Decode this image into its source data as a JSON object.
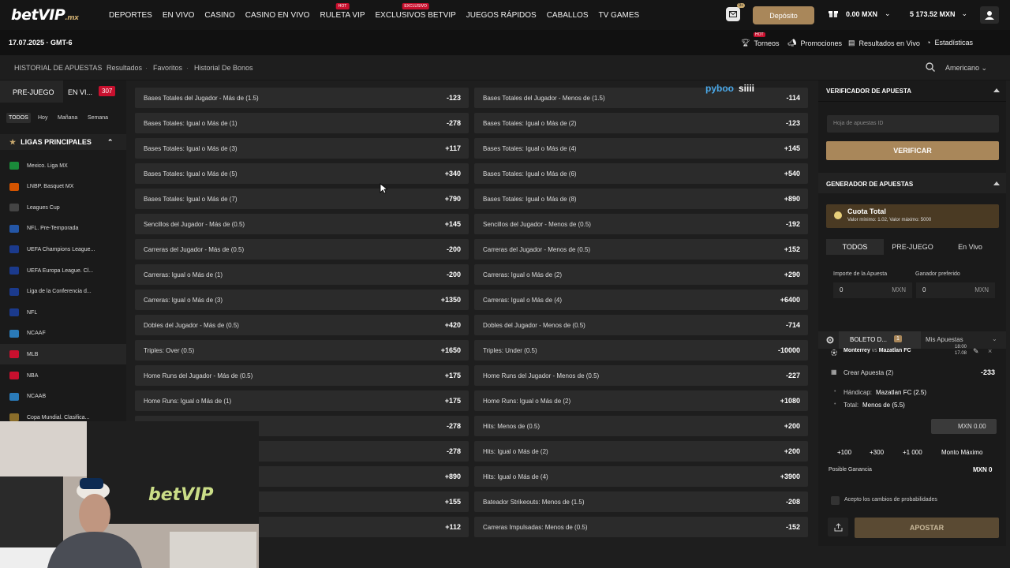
{
  "brand": {
    "logo": "betVIP",
    "logo_suffix": ".mx"
  },
  "nav": {
    "items": [
      {
        "label": "DEPORTES"
      },
      {
        "label": "EN VIVO"
      },
      {
        "label": "CASINO"
      },
      {
        "label": "CASINO EN VIVO"
      },
      {
        "label": "RULETA VIP",
        "badge": "HOT"
      },
      {
        "label": "EXCLUSIVOS BETVIP",
        "badge": "EXCLUSIVO"
      },
      {
        "label": "JUEGOS RÁPIDOS"
      },
      {
        "label": "CABALLOS"
      },
      {
        "label": "TV GAMES"
      }
    ],
    "mail_count": "9+",
    "deposit_label": "Depósito",
    "balance_bonus": "0.00 MXN",
    "balance_main": "5 173.52 MXN"
  },
  "subbar": {
    "date": "17.07.2025 · GMT-6",
    "torneos": "Torneos",
    "torneos_badge": "HOT",
    "promociones": "Promociones",
    "resultados": "Resultados en Vivo",
    "estadisticas": "Estadísticas"
  },
  "breadcrumbs": [
    "HISTORIAL DE APUESTAS",
    "Resultados",
    "Favoritos",
    "Historial De Bonos"
  ],
  "odds_format": "Americano",
  "sidebar": {
    "tab_prematch": "PRE-JUEGO",
    "tab_live": "EN VI...",
    "live_count": "307",
    "filters": [
      "TODOS",
      "Hoy",
      "Mañana",
      "Semana"
    ],
    "ligas_title": "LIGAS PRINCIPALES",
    "leagues": [
      {
        "label": "Mexico. Liga MX",
        "color": "#1a8a3a"
      },
      {
        "label": "LNBP. Basquet MX",
        "color": "#d35400"
      },
      {
        "label": "Leagues Cup",
        "color": "#444"
      },
      {
        "label": "NFL. Pre-Temporada",
        "color": "#2456a6"
      },
      {
        "label": "UEFA Champions League...",
        "color": "#1b3a8c"
      },
      {
        "label": "UEFA Europa League. Cl...",
        "color": "#1b3a8c"
      },
      {
        "label": "Liga de la Conferencia d...",
        "color": "#1b3a8c"
      },
      {
        "label": "NFL",
        "color": "#1b3a8c"
      },
      {
        "label": "NCAAF",
        "color": "#2a7ab8"
      },
      {
        "label": "MLB",
        "color": "#c8102e"
      },
      {
        "label": "NBA",
        "color": "#c8102e"
      },
      {
        "label": "NCAAB",
        "color": "#2a7ab8"
      },
      {
        "label": "Copa Mundial. Clasifica...",
        "color": "#8a6d2a"
      }
    ]
  },
  "markets_left": [
    {
      "label": "Bases Totales del Jugador - Más de (1.5)",
      "odd": "-123"
    },
    {
      "label": "Bases Totales: Igual o Más de (1)",
      "odd": "-278"
    },
    {
      "label": "Bases Totales: Igual o Más de (3)",
      "odd": "+117"
    },
    {
      "label": "Bases Totales: Igual o Más de (5)",
      "odd": "+340"
    },
    {
      "label": "Bases Totales: Igual o Más de (7)",
      "odd": "+790"
    },
    {
      "label": "Sencillos del Jugador - Más de (0.5)",
      "odd": "+145"
    },
    {
      "label": "Carreras del Jugador - Más de (0.5)",
      "odd": "-200"
    },
    {
      "label": "Carreras: Igual o Más de (1)",
      "odd": "-200"
    },
    {
      "label": "Carreras: Igual o Más de (3)",
      "odd": "+1350"
    },
    {
      "label": "Dobles del Jugador - Más de (0.5)",
      "odd": "+420"
    },
    {
      "label": "Triples: Over (0.5)",
      "odd": "+1650"
    },
    {
      "label": "Home Runs del Jugador - Más de (0.5)",
      "odd": "+175"
    },
    {
      "label": "Home Runs: Igual o Más de (1)",
      "odd": "+175"
    },
    {
      "label": "",
      "odd": "-278"
    },
    {
      "label": "",
      "odd": "-278"
    },
    {
      "label": "",
      "odd": "+890"
    },
    {
      "label": "",
      "odd": "+155"
    },
    {
      "label": "",
      "odd": "+112"
    }
  ],
  "markets_right": [
    {
      "label": "Bases Totales del Jugador - Menos de (1.5)",
      "odd": "-114"
    },
    {
      "label": "Bases Totales: Igual o Más de (2)",
      "odd": "-123"
    },
    {
      "label": "Bases Totales: Igual o Más de (4)",
      "odd": "+145"
    },
    {
      "label": "Bases Totales: Igual o Más de (6)",
      "odd": "+540"
    },
    {
      "label": "Bases Totales: Igual o Más de (8)",
      "odd": "+890"
    },
    {
      "label": "Sencillos del Jugador - Menos de (0.5)",
      "odd": "-192"
    },
    {
      "label": "Carreras del Jugador - Menos de (0.5)",
      "odd": "+152"
    },
    {
      "label": "Carreras: Igual o Más de (2)",
      "odd": "+290"
    },
    {
      "label": "Carreras: Igual o Más de (4)",
      "odd": "+6400"
    },
    {
      "label": "Dobles del Jugador - Menos de (0.5)",
      "odd": "-714"
    },
    {
      "label": "Triples: Under (0.5)",
      "odd": "-10000"
    },
    {
      "label": "Home Runs del Jugador - Menos de (0.5)",
      "odd": "-227"
    },
    {
      "label": "Home Runs: Igual o Más de (2)",
      "odd": "+1080"
    },
    {
      "label": "Hits: Menos de (0.5)",
      "odd": "+200"
    },
    {
      "label": "Hits: Igual o Más de (2)",
      "odd": "+200"
    },
    {
      "label": "Hits: Igual o Más de (4)",
      "odd": "+3900"
    },
    {
      "label": "Bateador Strikeouts: Menos de (1.5)",
      "odd": "-208"
    },
    {
      "label": "Carreras Impulsadas: Menos de (0.5)",
      "odd": "-152"
    }
  ],
  "watermark": {
    "a": "pyboo",
    "b": "siiii"
  },
  "verifier": {
    "title": "VERIFICADOR DE APUESTA",
    "placeholder": "Hoja de apuestas ID",
    "button": "VERIFICAR"
  },
  "generator": {
    "title": "GENERADOR DE APUESTAS",
    "cuota_title": "Cuota Total",
    "cuota_sub": "Valor mínimo: 1.02, Valor máximo: 5000",
    "tabs": [
      "TODOS",
      "PRE-JUEGO",
      "En Vivo"
    ],
    "importe_label": "Importe de la Apuesta",
    "ganador_label": "Ganador preferido",
    "importe_value": "0",
    "ganador_value": "0",
    "currency": "MXN"
  },
  "slip": {
    "tab_boleto": "BOLETO D...",
    "boleto_count": "1",
    "tab_mis": "Mis Apuestas",
    "match": "Monterrey vs Mazatlan FC",
    "match_team1": "Monterrey",
    "match_vs": "vs",
    "match_team2": "Mazatlan FC",
    "time": "18:00",
    "date": "17.08",
    "create": "Crear Apuesta (2)",
    "create_odd": "-233",
    "leg1_label": "Hándicap:",
    "leg1_value": "Mazatlan FC (2.5)",
    "leg2_label": "Total:",
    "leg2_value": "Menos de (5.5)",
    "stake": "MXN 0.00",
    "quick": [
      "+100",
      "+300",
      "+1 000"
    ],
    "max": "Monto Máximo",
    "win_label": "Posible Ganancia",
    "win_value": "MXN 0",
    "accept": "Acepto los cambios de probabilidades",
    "place": "APOSTAR"
  }
}
